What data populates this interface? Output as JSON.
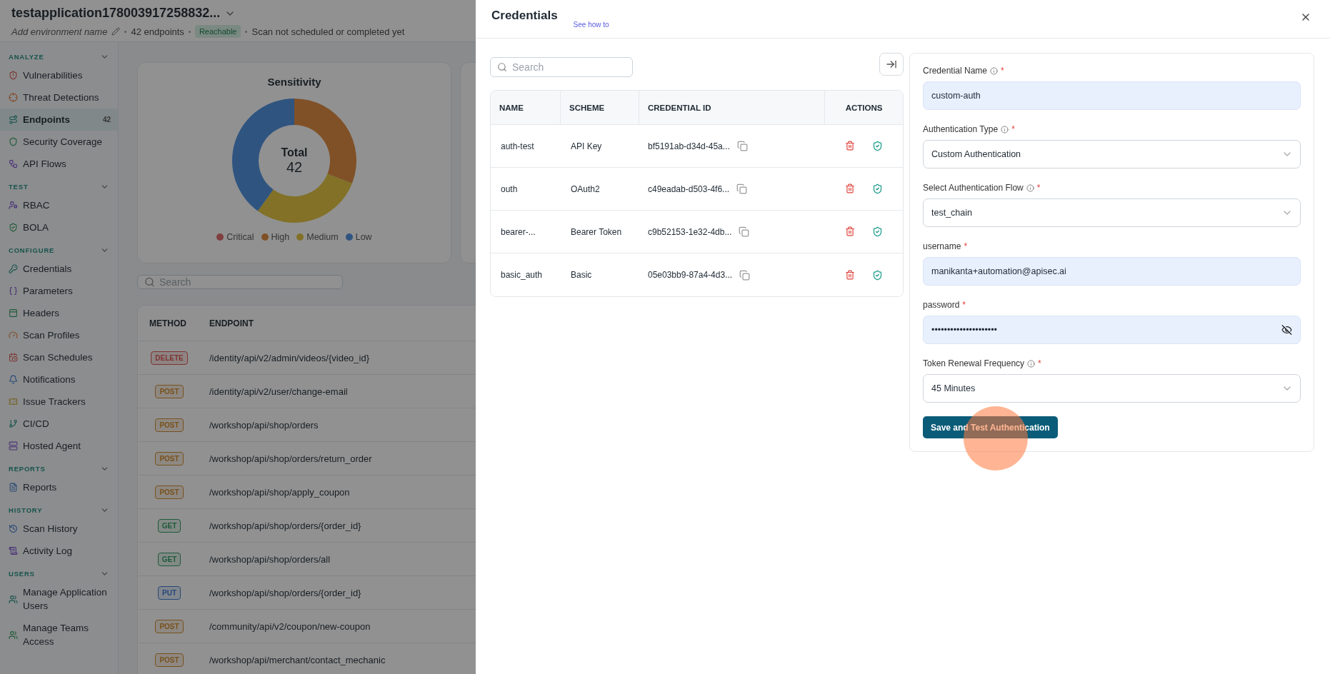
{
  "app": {
    "title": "testapplication178003917258832...",
    "environment_placeholder": "Add environment name",
    "endpoint_count": "42 endpoints",
    "status_badge": "Reachable",
    "scan_status": "Scan not scheduled or completed yet"
  },
  "sidebar": {
    "sections": [
      {
        "label": "ANALYZE",
        "expanded": true,
        "items": [
          {
            "label": "Vulnerabilities",
            "selected": false
          },
          {
            "label": "Threat Detections",
            "selected": false
          },
          {
            "label": "Endpoints",
            "count": "42",
            "selected": true
          },
          {
            "label": "Security Coverage",
            "selected": false
          },
          {
            "label": "API Flows",
            "selected": false
          }
        ]
      },
      {
        "label": "TEST",
        "expanded": true,
        "items": [
          {
            "label": "RBAC",
            "selected": false
          },
          {
            "label": "BOLA",
            "selected": false
          }
        ]
      },
      {
        "label": "CONFIGURE",
        "expanded": true,
        "items": [
          {
            "label": "Credentials",
            "selected": false
          },
          {
            "label": "Parameters",
            "selected": false
          },
          {
            "label": "Headers",
            "selected": false
          },
          {
            "label": "Scan Profiles",
            "selected": false
          },
          {
            "label": "Scan Schedules",
            "selected": false
          },
          {
            "label": "Notifications",
            "selected": false
          },
          {
            "label": "Issue Trackers",
            "selected": false
          },
          {
            "label": "CI/CD",
            "selected": false
          },
          {
            "label": "Hosted Agent",
            "selected": false
          }
        ]
      },
      {
        "label": "REPORTS",
        "expanded": true,
        "items": [
          {
            "label": "Reports",
            "selected": false
          }
        ]
      },
      {
        "label": "HISTORY",
        "expanded": true,
        "items": [
          {
            "label": "Scan History",
            "selected": false
          },
          {
            "label": "Activity Log",
            "selected": false
          }
        ]
      },
      {
        "label": "USERS",
        "expanded": true,
        "items": [
          {
            "label": "Manage Application Users",
            "selected": false
          },
          {
            "label": "Manage Teams Access",
            "selected": false
          }
        ]
      }
    ]
  },
  "sensitivity": {
    "title": "Sensitivity",
    "total_label": "Total",
    "total_value": "42",
    "legend": [
      {
        "label": "Critical"
      },
      {
        "label": "High"
      },
      {
        "label": "Medium"
      },
      {
        "label": "Low"
      }
    ]
  },
  "endpoint_search": {
    "placeholder": "Search"
  },
  "endpoints": {
    "columns": [
      "METHOD",
      "ENDPOINT"
    ],
    "rows": [
      {
        "method": "DELETE",
        "kind": "delete",
        "path": "/identity/api/v2/admin/videos/{video_id}"
      },
      {
        "method": "POST",
        "kind": "post",
        "path": "/identity/api/v2/user/change-email"
      },
      {
        "method": "POST",
        "kind": "post",
        "path": "/workshop/api/shop/orders"
      },
      {
        "method": "POST",
        "kind": "post",
        "path": "/workshop/api/shop/orders/return_order"
      },
      {
        "method": "POST",
        "kind": "post",
        "path": "/workshop/api/shop/apply_coupon"
      },
      {
        "method": "GET",
        "kind": "get",
        "path": "/workshop/api/shop/orders/{order_id}"
      },
      {
        "method": "GET",
        "kind": "get",
        "path": "/workshop/api/shop/orders/all"
      },
      {
        "method": "PUT",
        "kind": "put",
        "path": "/workshop/api/shop/orders/{order_id}"
      },
      {
        "method": "POST",
        "kind": "post",
        "path": "/community/api/v2/coupon/new-coupon"
      },
      {
        "method": "POST",
        "kind": "post",
        "path": "/workshop/api/merchant/contact_mechanic"
      }
    ]
  },
  "drawer": {
    "title": "Credentials",
    "help_link": "See how to",
    "search": {
      "placeholder": "Search"
    },
    "table": {
      "columns": [
        "NAME",
        "SCHEME",
        "CREDENTIAL ID",
        "ACTIONS"
      ],
      "rows": [
        {
          "name": "auth-test",
          "scheme": "API Key",
          "credential_id": "bf5191ab-d34d-45a..."
        },
        {
          "name": "outh",
          "scheme": "OAuth2",
          "credential_id": "c49eadab-d503-4f6..."
        },
        {
          "name": "bearer-...",
          "scheme": "Bearer Token",
          "credential_id": "c9b52153-1e32-4db..."
        },
        {
          "name": "basic_auth",
          "scheme": "Basic",
          "credential_id": "05e03bb9-87a4-4d3..."
        }
      ]
    },
    "form": {
      "fields": [
        {
          "kind": "text",
          "label": "Credential Name",
          "info": true,
          "required_mark": "*",
          "value": "custom-auth"
        },
        {
          "kind": "select",
          "label": "Authentication Type",
          "info": true,
          "required_mark": "*",
          "value": "Custom Authentication"
        },
        {
          "kind": "select",
          "label": "Select Authentication Flow",
          "info": true,
          "required_mark": "*",
          "value": "test_chain"
        },
        {
          "kind": "text",
          "label": "username",
          "info": false,
          "required_mark": "*",
          "value": "manikanta+automation@apisec.ai"
        },
        {
          "kind": "password",
          "label": "password",
          "info": false,
          "required_mark": "*",
          "value": "•••••••••••••••••••••"
        },
        {
          "kind": "select",
          "label": "Token Renewal Frequency",
          "info": true,
          "required_mark": "*",
          "value": "45 Minutes"
        }
      ],
      "submit": "Save and Test Authentication"
    }
  }
}
